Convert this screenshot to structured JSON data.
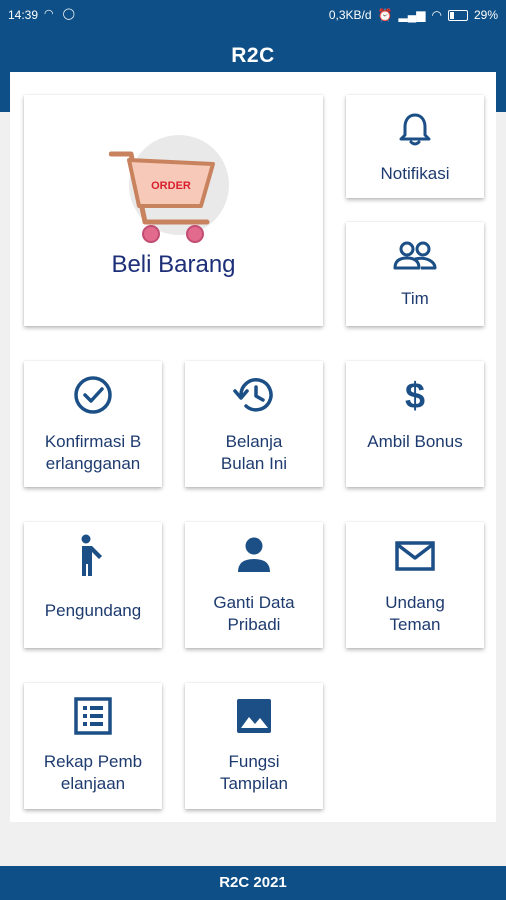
{
  "status_bar": {
    "time": "14:39",
    "network_speed": "0,3KB/d",
    "battery": "29%"
  },
  "app": {
    "title": "R2C"
  },
  "order_badge": "ORDER",
  "menu": [
    {
      "id": "beli-barang",
      "label": "Beli Barang",
      "icon": "shopping-cart-icon"
    },
    {
      "id": "notifikasi",
      "label": "Notifikasi",
      "icon": "bell-icon"
    },
    {
      "id": "tim",
      "label": "Tim",
      "icon": "people-icon"
    },
    {
      "id": "konfirmasi",
      "label": "Konfirmasi B erlangganan",
      "icon": "check-circle-icon"
    },
    {
      "id": "belanja",
      "label": "Belanja Bulan Ini",
      "icon": "history-icon"
    },
    {
      "id": "bonus",
      "label": "Ambil Bonus",
      "icon": "dollar-icon"
    },
    {
      "id": "pengundang",
      "label": "Pengundang",
      "icon": "person-waving-icon"
    },
    {
      "id": "ganti-data",
      "label": "Ganti Data Pribadi",
      "icon": "person-icon"
    },
    {
      "id": "undang",
      "label": "Undang Teman",
      "icon": "mail-icon"
    },
    {
      "id": "rekap",
      "label": "Rekap Pemb elanjaan",
      "icon": "list-icon"
    },
    {
      "id": "fungsi",
      "label": "Fungsi Tampilan",
      "icon": "image-icon"
    }
  ],
  "colors": {
    "primary": "#0d4f86",
    "icon": "#1b4f86",
    "text": "#1e3b6f"
  },
  "footer": {
    "text": "R2C 2021"
  }
}
